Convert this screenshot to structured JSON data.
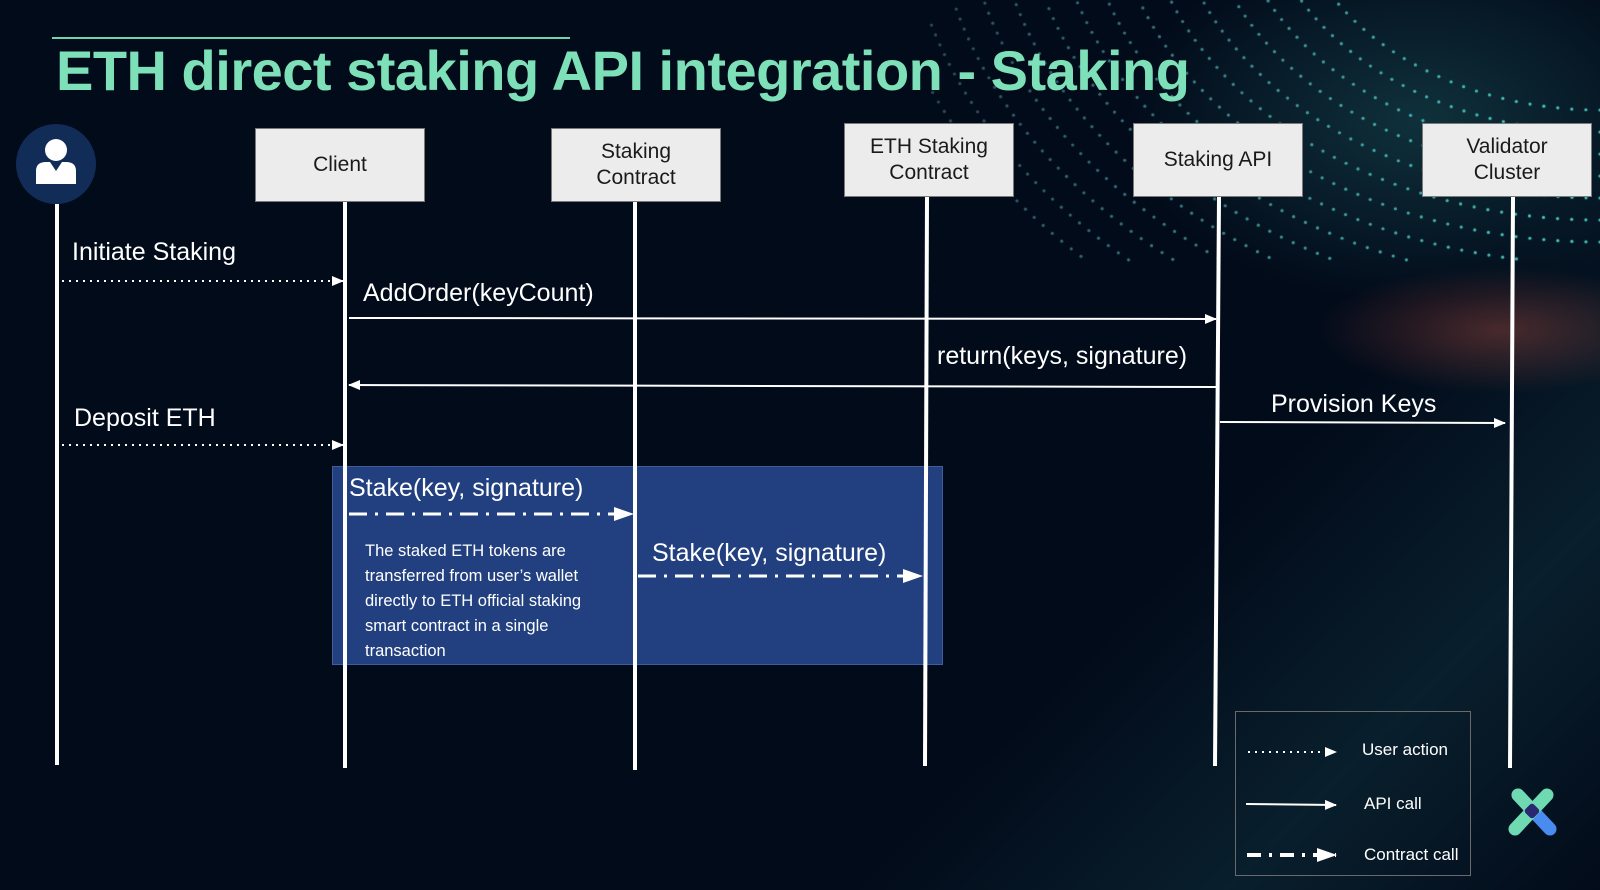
{
  "slide": {
    "title": "ETH direct staking API integration - Staking"
  },
  "actor": {
    "icon": "user-icon"
  },
  "participants": [
    {
      "id": "client",
      "label": "Client"
    },
    {
      "id": "staking-contract",
      "label": "Staking\nContract"
    },
    {
      "id": "eth-staking-contract",
      "label": "ETH Staking\nContract"
    },
    {
      "id": "staking-api",
      "label": "Staking API"
    },
    {
      "id": "validator-cluster",
      "label": "Validator\nCluster"
    }
  ],
  "messages": [
    {
      "label": "Initiate Staking",
      "from": "user",
      "to": "client",
      "type": "user-action"
    },
    {
      "label": "AddOrder(keyCount)",
      "from": "client",
      "to": "staking-api",
      "type": "api-call"
    },
    {
      "label": "return(keys, signature)",
      "from": "staking-api",
      "to": "client",
      "type": "api-call"
    },
    {
      "label": "Provision Keys",
      "from": "staking-api",
      "to": "validator-cluster",
      "type": "api-call"
    },
    {
      "label": "Deposit ETH",
      "from": "user",
      "to": "client",
      "type": "user-action"
    },
    {
      "label": "Stake(key, signature)",
      "from": "client",
      "to": "staking-contract",
      "type": "contract-call"
    },
    {
      "label": "Stake(key, signature)",
      "from": "staking-contract",
      "to": "eth-staking-contract",
      "type": "contract-call"
    }
  ],
  "note": {
    "text": "The staked ETH tokens are transferred from user’s wallet directly to ETH official staking smart contract in a single transaction"
  },
  "legend": [
    {
      "type": "user-action",
      "label": "User action"
    },
    {
      "type": "api-call",
      "label": "API call"
    },
    {
      "type": "contract-call",
      "label": "Contract call"
    }
  ],
  "colors": {
    "background": "#020b1a",
    "title": "#7ee0b8",
    "participant_fill": "#ececec",
    "region_fill": "#22407f",
    "actor_circle": "#112d57",
    "logo_green": "#6fd9b2",
    "logo_blue": "#4a8bf0",
    "logo_center": "#2a2872"
  }
}
